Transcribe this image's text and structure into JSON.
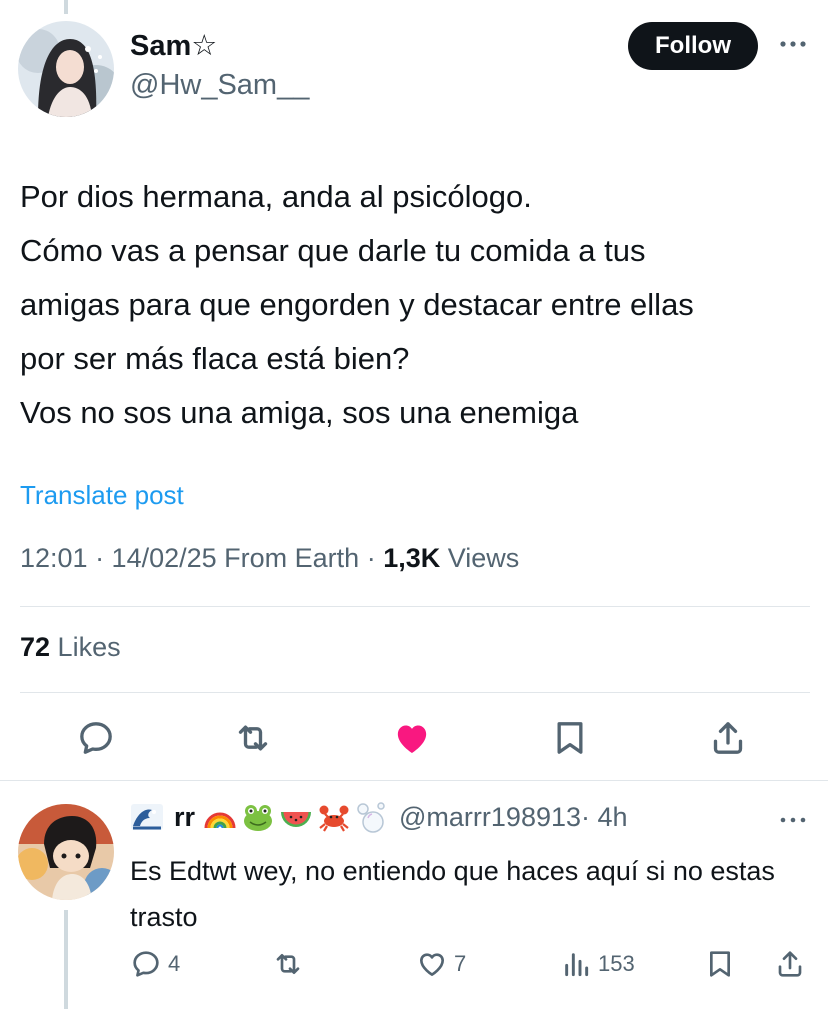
{
  "tweet": {
    "display_name": "Sam☆",
    "handle": "@Hw_Sam__",
    "follow_label": "Follow",
    "text_lines": [
      "Por dios hermana, anda al psicólogo.",
      "Cómo vas a pensar que darle tu comida a tus",
      "amigas para que engorden y destacar entre ellas",
      "por ser más flaca está bien?",
      "Vos no sos una amiga, sos una enemiga"
    ],
    "translate_label": "Translate post",
    "time": "12:01 · 14/02/25 From Earth · ",
    "views_count": "1,3K",
    "views_label": " Views",
    "likes_count": "72",
    "likes_label": " Likes",
    "liked": true,
    "like_color": "#f91880",
    "icons": [
      "reply-icon",
      "retweet-icon",
      "heart-filled-icon",
      "bookmark-icon",
      "share-icon"
    ]
  },
  "reply": {
    "name_prefix_emoji": "🌊",
    "display_name": "rr",
    "name_suffix_emojis": [
      "🌈",
      "🐸",
      "🍉",
      "🦀",
      "🫧"
    ],
    "handle": "@marrr198913",
    "time": " · 4h",
    "text": "Es Edtwt wey, no entiendo que haces aquí si no estas trasto",
    "replies": "4",
    "likes": "7",
    "views": "153"
  },
  "colors": {
    "text": "#0f1419",
    "secondary": "#536471",
    "link": "#1d9bf0",
    "divider": "#e1e6ea"
  }
}
